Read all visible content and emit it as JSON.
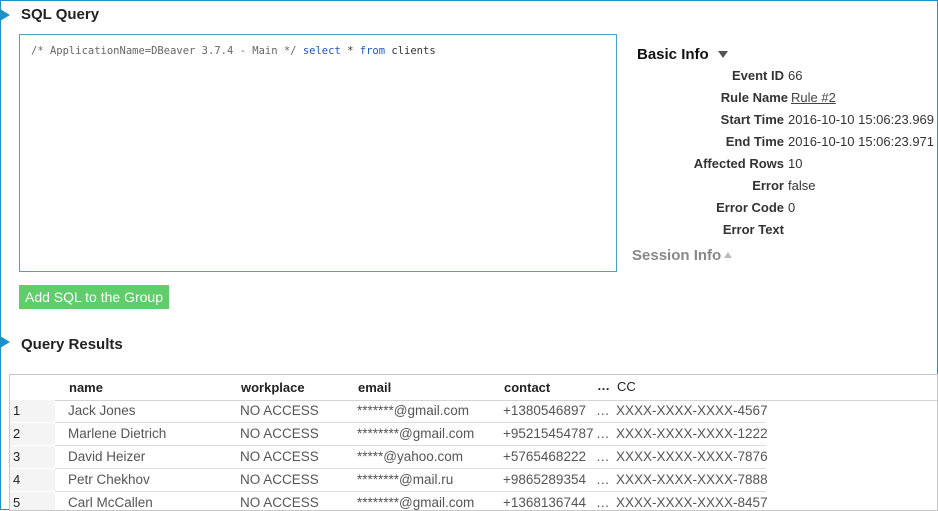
{
  "sql_section": {
    "title": "SQL Query",
    "query_comment": "/* ApplicationName=DBeaver 3.7.4 - Main */",
    "query_select": "select",
    "query_star": "*",
    "query_from": "from",
    "query_table": "clients",
    "add_button_label": "Add SQL to the Group"
  },
  "basic_info": {
    "title": "Basic Info",
    "rows": [
      {
        "label": "Event ID",
        "value": "66"
      },
      {
        "label": "Rule Name",
        "value": "Rule #2"
      },
      {
        "label": "Start Time",
        "value": "2016-10-10 15:06:23.969"
      },
      {
        "label": "End Time",
        "value": "2016-10-10 15:06:23.971"
      },
      {
        "label": "Affected Rows",
        "value": "10"
      },
      {
        "label": "Error",
        "value": "false"
      },
      {
        "label": "Error Code",
        "value": "0"
      },
      {
        "label": "Error Text",
        "value": ""
      }
    ]
  },
  "session_info": {
    "title": "Session Info"
  },
  "results_section": {
    "title": "Query Results",
    "columns": [
      "name",
      "workplace",
      "email",
      "contact",
      "…",
      "CC"
    ],
    "rows": [
      {
        "idx": "1",
        "name": "Jack Jones",
        "workplace": "NO ACCESS",
        "email": "*******@gmail.com",
        "contact": "+1380546897",
        "more": "…",
        "cc": "XXXX-XXXX-XXXX-4567"
      },
      {
        "idx": "2",
        "name": "Marlene Dietrich",
        "workplace": "NO ACCESS",
        "email": "********@gmail.com",
        "contact": "+95215454787",
        "more": "…",
        "cc": "XXXX-XXXX-XXXX-1222"
      },
      {
        "idx": "3",
        "name": "David Heizer",
        "workplace": "NO ACCESS",
        "email": "*****@yahoo.com",
        "contact": "+5765468222",
        "more": "…",
        "cc": "XXXX-XXXX-XXXX-7876"
      },
      {
        "idx": "4",
        "name": "Petr Chekhov",
        "workplace": "NO ACCESS",
        "email": "********@mail.ru",
        "contact": "+9865289354",
        "more": "…",
        "cc": "XXXX-XXXX-XXXX-7888"
      },
      {
        "idx": "5",
        "name": "Carl McCallen",
        "workplace": "NO ACCESS",
        "email": "********@gmail.com",
        "contact": "+1368136744",
        "more": "…",
        "cc": "XXXX-XXXX-XXXX-8457"
      }
    ]
  },
  "colors": {
    "accent": "#1b93c8",
    "button": "#5fcd6a"
  }
}
